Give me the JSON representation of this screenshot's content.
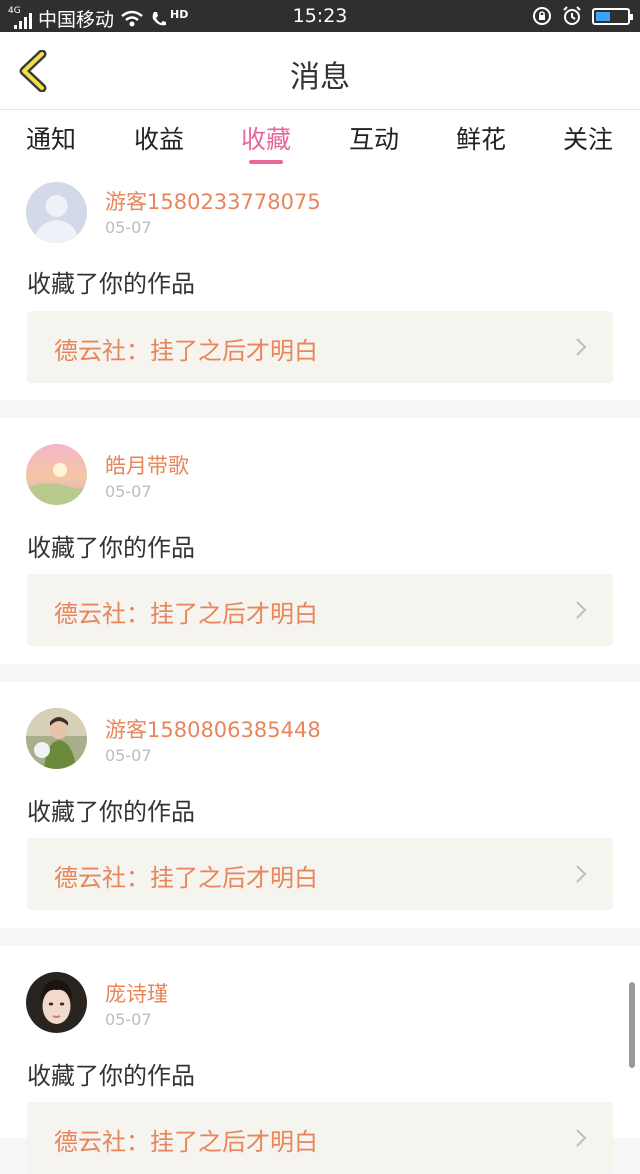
{
  "status_bar": {
    "network": "4G",
    "carrier": "中国移动",
    "hd": "HD",
    "time": "15:23",
    "battery_level": 0.45,
    "icons": [
      "signal-icon",
      "wifi-icon",
      "call-icon",
      "rotation-lock-icon",
      "alarm-icon",
      "battery-icon"
    ]
  },
  "header": {
    "title": "消息",
    "back_icon": "chevron-left-icon"
  },
  "tabs": [
    {
      "label": "通知"
    },
    {
      "label": "收益"
    },
    {
      "label": "收藏",
      "active": true
    },
    {
      "label": "互动"
    },
    {
      "label": "鲜花"
    },
    {
      "label": "关注"
    }
  ],
  "colors": {
    "accent_pink": "#e9679b",
    "name_orange": "#e8855a",
    "date_gray": "#bcbcbc",
    "work_bg": "#f5f4ef"
  },
  "notifications": [
    {
      "user": "游客1580233778075",
      "date": "05-07",
      "action": "收藏了你的作品",
      "work_title": "德云社：挂了之后才明白",
      "avatar": "default-avatar-icon"
    },
    {
      "user": "皓月带歌",
      "date": "05-07",
      "action": "收藏了你的作品",
      "work_title": "德云社：挂了之后才明白",
      "avatar": "landscape-avatar"
    },
    {
      "user": "游客1580806385448",
      "date": "05-07",
      "action": "收藏了你的作品",
      "work_title": "德云社：挂了之后才明白",
      "avatar": "person-avatar"
    },
    {
      "user": "庞诗瑾",
      "date": "05-07",
      "action": "收藏了你的作品",
      "work_title": "德云社：挂了之后才明白",
      "avatar": "woman-avatar"
    }
  ]
}
